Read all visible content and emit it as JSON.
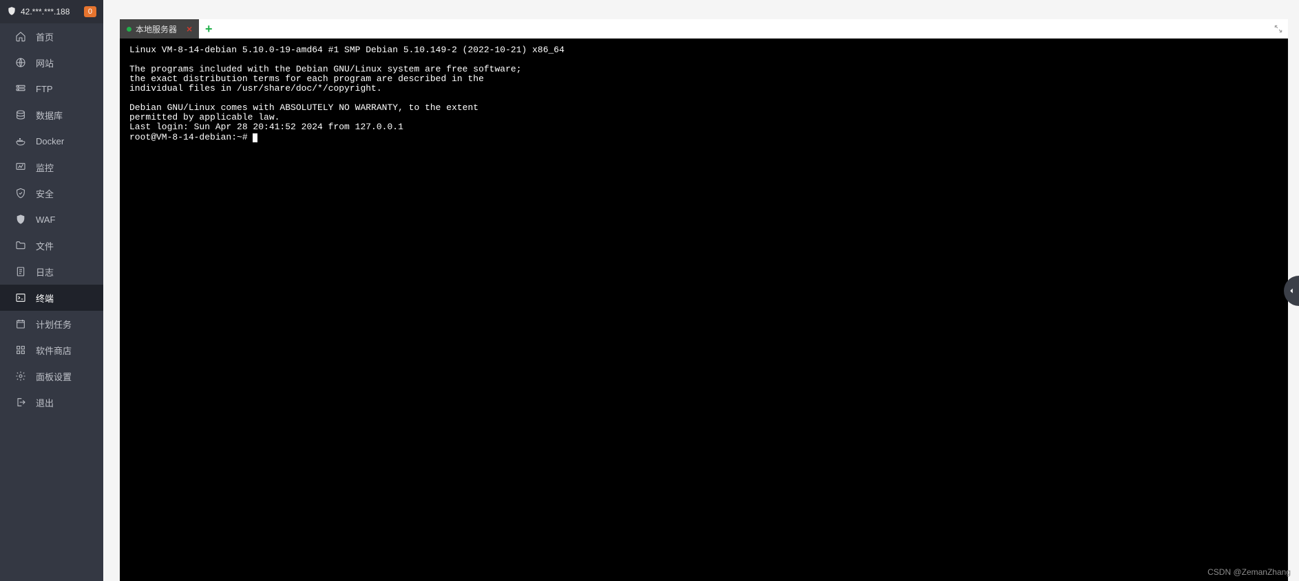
{
  "header": {
    "ip": "42.***.***.188",
    "badge": "0"
  },
  "sidebar": {
    "items": [
      {
        "icon": "home",
        "label": "首页"
      },
      {
        "icon": "globe",
        "label": "网站"
      },
      {
        "icon": "ftp",
        "label": "FTP"
      },
      {
        "icon": "database",
        "label": "数据库"
      },
      {
        "icon": "docker",
        "label": "Docker"
      },
      {
        "icon": "monitor",
        "label": "监控"
      },
      {
        "icon": "shield",
        "label": "安全"
      },
      {
        "icon": "waf",
        "label": "WAF"
      },
      {
        "icon": "folder",
        "label": "文件"
      },
      {
        "icon": "log",
        "label": "日志"
      },
      {
        "icon": "terminal",
        "label": "终端"
      },
      {
        "icon": "schedule",
        "label": "计划任务"
      },
      {
        "icon": "apps",
        "label": "软件商店"
      },
      {
        "icon": "gear",
        "label": "面板设置"
      },
      {
        "icon": "exit",
        "label": "退出"
      }
    ],
    "active_index": 10
  },
  "tabs": {
    "items": [
      {
        "label": "本地服务器",
        "connected": true
      }
    ],
    "add_label": "+"
  },
  "terminal": {
    "motd": "Linux VM-8-14-debian 5.10.0-19-amd64 #1 SMP Debian 5.10.149-2 (2022-10-21) x86_64\n\nThe programs included with the Debian GNU/Linux system are free software;\nthe exact distribution terms for each program are described in the\nindividual files in /usr/share/doc/*/copyright.\n\nDebian GNU/Linux comes with ABSOLUTELY NO WARRANTY, to the extent\npermitted by applicable law.\nLast login: Sun Apr 28 20:41:52 2024 from 127.0.0.1",
    "prompt": "root@VM-8-14-debian:~# "
  },
  "watermark": "CSDN @ZemanZhang"
}
